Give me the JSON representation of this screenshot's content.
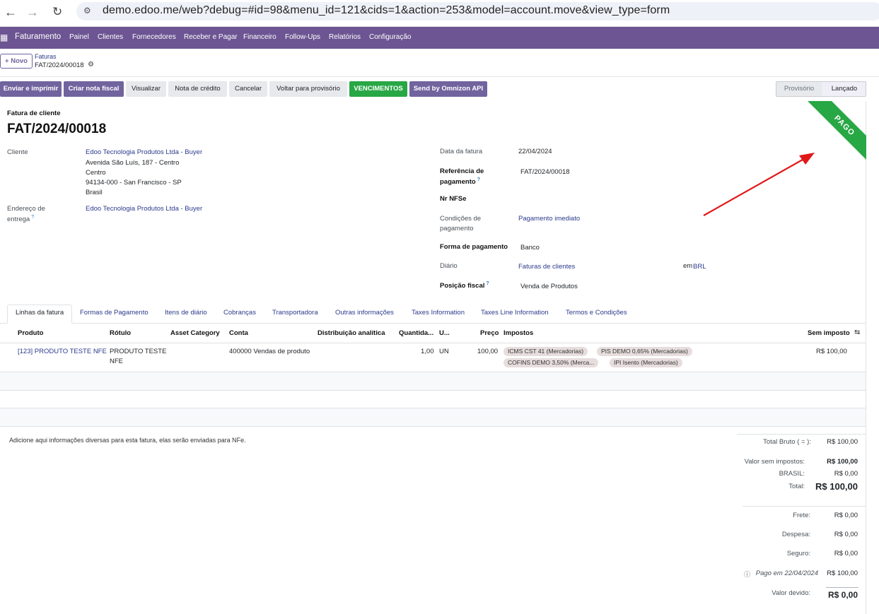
{
  "browser": {
    "url": "demo.edoo.me/web?debug=#id=98&menu_id=121&cids=1&action=253&model=account.move&view_type=form",
    "back_icon": "arrow-left-icon",
    "forward_icon": "arrow-right-icon",
    "reload_icon": "reload-icon"
  },
  "nav": {
    "brand": "Faturamento",
    "menu": [
      "Painel",
      "Clientes",
      "Fornecedores",
      "Receber e Pagar",
      "Financeiro",
      "Follow-Ups",
      "Relatórios",
      "Configuração"
    ]
  },
  "control": {
    "new_button": "+ Novo",
    "breadcrumb_parent": "Faturas",
    "breadcrumb_current": "FAT/2024/00018"
  },
  "actions": {
    "send_print": "Enviar e imprimir",
    "create_nf": "Criar nota fiscal",
    "preview": "Visualizar",
    "credit_note": "Nota de crédito",
    "cancel": "Cancelar",
    "reset_draft": "Voltar para provisório",
    "due_dates": "VENCIMENTOS",
    "omnizon": "Send by Omnizon API"
  },
  "statusbar": {
    "draft": "Provisório",
    "posted": "Lançado"
  },
  "ribbon": "PAGO",
  "form": {
    "type_label": "Fatura de cliente",
    "name": "FAT/2024/00018",
    "customer_label": "Cliente",
    "customer_name": "Edoo Tecnologia Produtos Ltda - Buyer",
    "address_lines": [
      "Avenida São Luís, 187 - Centro",
      "Centro",
      "94134-000 - San Francisco - SP",
      "Brasil"
    ],
    "delivery_label_1": "Endereço de",
    "delivery_label_2": "entrega",
    "delivery_value": "Edoo Tecnologia Produtos Ltda - Buyer",
    "invoice_date_label": "Data da fatura",
    "invoice_date": "22/04/2024",
    "payment_ref_label_1": "Referência de",
    "payment_ref_label_2": "pagamento",
    "payment_ref": "FAT/2024/00018",
    "nfse_label": "Nr NFSe",
    "terms_label_1": "Condições de",
    "terms_label_2": "pagamento",
    "terms_value": "Pagamento imediato",
    "payment_method_label": "Forma de pagamento",
    "payment_method": "Banco",
    "journal_label": "Diário",
    "journal_value": "Faturas de clientes",
    "currency_prefix": "em",
    "currency": "BRL",
    "fiscal_position_label": "Posição fiscal",
    "fiscal_position": "Venda de Produtos",
    "help_mark": "?"
  },
  "tabs": [
    "Linhas da fatura",
    "Formas de Pagamento",
    "Itens de diário",
    "Cobranças",
    "Transportadora",
    "Outras informações",
    "Taxes Information",
    "Taxes Line Information",
    "Termos e Condições"
  ],
  "table": {
    "headers": {
      "product": "Produto",
      "label": "Rótulo",
      "asset": "Asset Category",
      "account": "Conta",
      "analytic": "Distribuição analítica",
      "quantity": "Quantida...",
      "uom": "U...",
      "price": "Preço",
      "taxes": "Impostos",
      "subtotal": "Sem imposto"
    },
    "row": {
      "product": "[123] PRODUTO TESTE NFE",
      "label_1": "PRODUTO TESTE",
      "label_2": "NFE",
      "account": "400000 Vendas de produto",
      "quantity": "1,00",
      "uom": "UN",
      "price": "100,00",
      "taxes": [
        "ICMS CST 41 (Mercadorias)",
        "PIS DEMO 0,65% (Mercadorias)",
        "COFINS DEMO 3,50% (Merca...",
        "IPI Isento (Mercadorias)"
      ],
      "subtotal": "R$ 100,00"
    },
    "settings_icon": "column-settings-icon"
  },
  "notes_placeholder": "Adicione aqui informações diversas para esta fatura, elas serão enviadas para NFe.",
  "totals": {
    "gross_label": "Total Bruto ( = ):",
    "gross": "R$ 100,00",
    "untaxed_label": "Valor sem impostos:",
    "untaxed": "R$ 100,00",
    "brasil_label": "BRASIL:",
    "brasil": "R$ 0,00",
    "total_label": "Total:",
    "total": "R$ 100,00",
    "freight_label": "Frete:",
    "freight": "R$ 0,00",
    "expense_label": "Despesa:",
    "expense": "R$ 0,00",
    "insurance_label": "Seguro:",
    "insurance": "R$ 0,00",
    "paid_label": "Pago em 22/04/2024",
    "paid": "R$ 100,00",
    "due_label": "Valor devido:",
    "due": "R$ 0,00"
  },
  "colors": {
    "navbar": "#6c5592",
    "primary_button": "#71639e",
    "ribbon": "#28a745",
    "link": "#2b3a8b",
    "annotation_arrow": "#e01818"
  }
}
